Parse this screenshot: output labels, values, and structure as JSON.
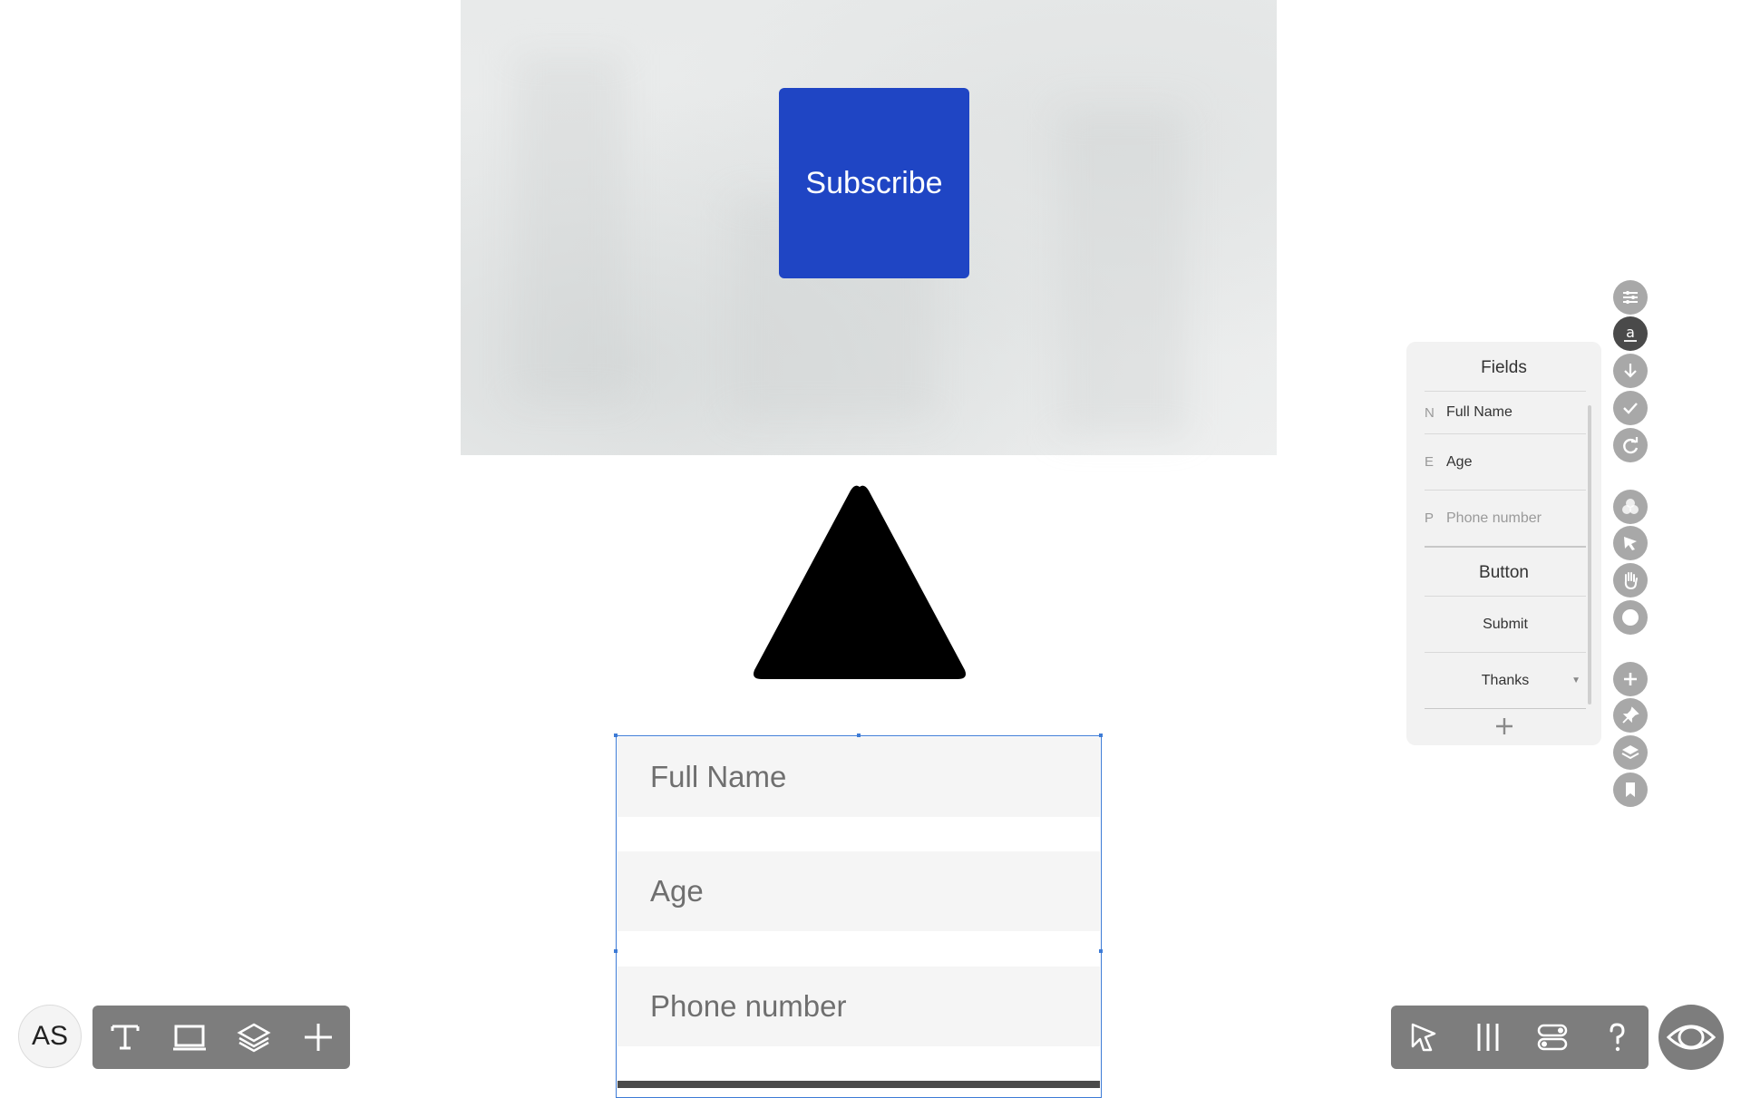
{
  "canvas": {
    "subscribe_label": "Subscribe",
    "form": {
      "fields": [
        {
          "placeholder": "Full Name"
        },
        {
          "placeholder": "Age"
        },
        {
          "placeholder": "Phone number"
        }
      ]
    }
  },
  "user": {
    "initials": "AS"
  },
  "toolbar_left": {
    "icons": [
      "text-tool-icon",
      "frame-tool-icon",
      "layers-icon",
      "add-icon"
    ]
  },
  "toolbar_right": {
    "icons": [
      "select-tool-icon",
      "columns-icon",
      "toggle-icon",
      "help-icon"
    ]
  },
  "preview": {
    "icon": "eye-icon"
  },
  "side_rail": {
    "icons": [
      "adjust-icon",
      "text-style-icon",
      "download-icon",
      "check-icon",
      "redo-icon",
      "colors-icon",
      "pointer-icon",
      "hand-icon",
      "shadow-icon",
      "add-icon",
      "pin-icon",
      "layers-icon",
      "bookmark-icon"
    ],
    "active": "text-style-icon"
  },
  "fields_panel": {
    "title": "Fields",
    "fields": [
      {
        "letter": "N",
        "label": "Full Name"
      },
      {
        "letter": "E",
        "label": "Age"
      },
      {
        "letter": "P",
        "label": "Phone number"
      }
    ],
    "button_section_title": "Button",
    "button_items": [
      {
        "label": "Submit"
      },
      {
        "label": "Thanks"
      }
    ]
  },
  "colors": {
    "subscribe_bg": "#1f45c4",
    "selection": "#3d7bd6",
    "toolbar": "#7d7d7d",
    "rail_active": "#4a4a4a"
  }
}
